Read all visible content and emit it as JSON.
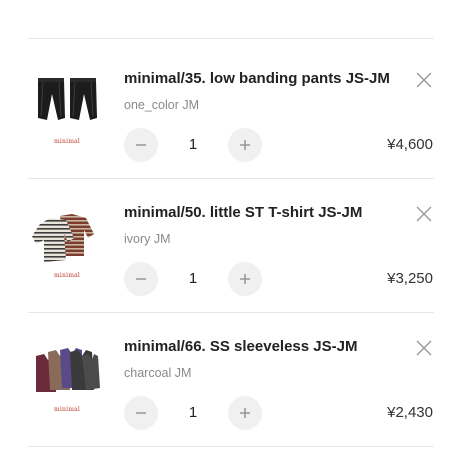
{
  "cart": {
    "items": [
      {
        "title": "minimal/35. low banding pants JS-JM",
        "variant": "one_color JM",
        "quantity": "1",
        "price": "¥4,600",
        "brand": "minimal",
        "thumbnail": "black-pants-icon"
      },
      {
        "title": "minimal/50. little ST T-shirt JS-JM",
        "variant": "ivory JM",
        "quantity": "1",
        "price": "¥3,250",
        "brand": "minimal",
        "thumbnail": "striped-tshirts-icon"
      },
      {
        "title": "minimal/66. SS sleeveless JS-JM",
        "variant": "charcoal JM",
        "quantity": "1",
        "price": "¥2,430",
        "brand": "minimal",
        "thumbnail": "sleeveless-tops-icon"
      }
    ],
    "icons": {
      "remove": "close-icon",
      "decrease": "minus-icon",
      "increase": "plus-icon"
    },
    "colors": {
      "brand_red": "#c0392b",
      "stepper_bg": "#f0f0f0",
      "divider": "#e6e6e6"
    }
  }
}
